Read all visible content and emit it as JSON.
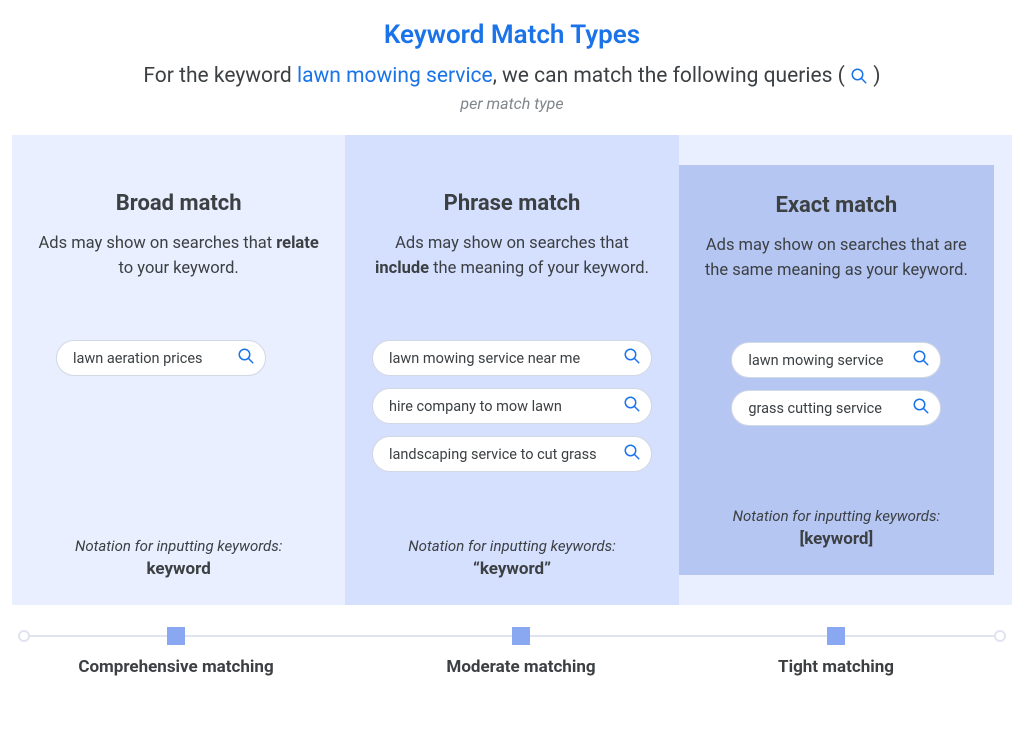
{
  "title": "Keyword Match Types",
  "subtitle_pre": "For the keyword ",
  "subtitle_kw": "lawn mowing service",
  "subtitle_post": ", we can match the following queries ( ",
  "subtitle_end": " )",
  "per_match": "per match type",
  "cols": {
    "broad": {
      "heading": "Broad match",
      "desc_pre": "Ads may show on searches that ",
      "desc_bold": "relate",
      "desc_post": " to your keyword.",
      "notation_label": "Notation for inputting keywords:",
      "notation_value": "keyword",
      "pills": [
        "lawn aeration prices"
      ]
    },
    "phrase": {
      "heading": "Phrase match",
      "desc_pre": "Ads may show on searches that ",
      "desc_bold": "include",
      "desc_post": " the meaning of your keyword.",
      "notation_label": "Notation for inputting keywords:",
      "notation_value": "“keyword”",
      "pills": [
        "lawn mowing service near me",
        "hire company to mow lawn",
        "landscaping service to cut grass"
      ]
    },
    "exact": {
      "heading": "Exact match",
      "desc_full": "Ads may show on searches that are the same meaning as your keyword.",
      "notation_label": "Notation for inputting keywords:",
      "notation_value": "[keyword]",
      "pills": [
        "lawn mowing service",
        "grass cutting service"
      ]
    }
  },
  "scale": {
    "left": "Comprehensive matching",
    "mid": "Moderate matching",
    "right": "Tight matching"
  }
}
